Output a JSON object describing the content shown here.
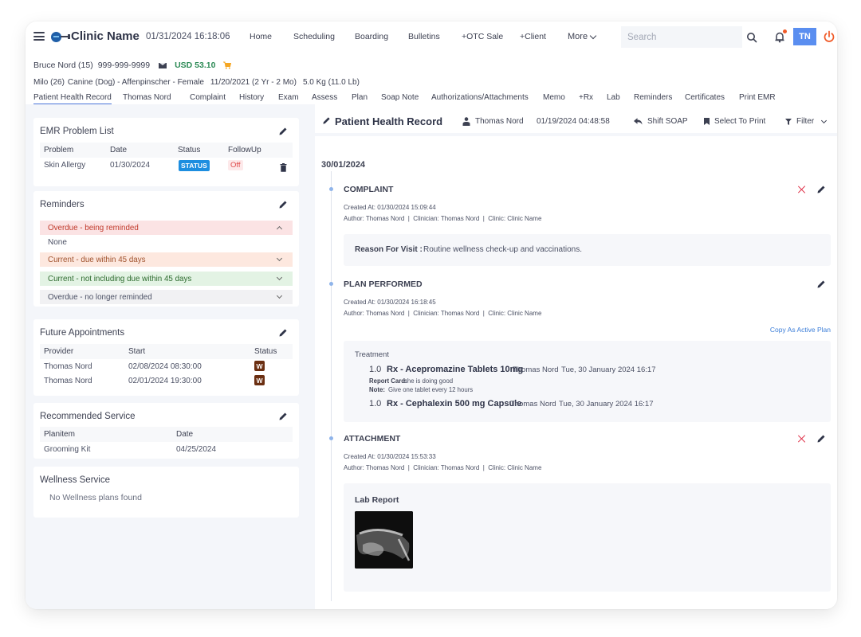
{
  "topbar": {
    "clinic_name": "Clinic Name",
    "datetime": "01/31/2024 16:18:06",
    "nav": [
      "Home",
      "Scheduling",
      "Boarding",
      "Bulletins",
      "+OTC Sale",
      "+Client"
    ],
    "more_label": "More",
    "search_placeholder": "Search",
    "user_initials": "TN",
    "icons": {
      "menu": "hamburger-icon",
      "search": "search-icon",
      "notifications": "bell-icon",
      "logout": "power-icon"
    }
  },
  "client": {
    "name": "Bruce Nord (15)",
    "phone": "999-999-9999",
    "balance": "USD 53.10"
  },
  "patient": {
    "name": "Milo (26)",
    "species_breed_sex": "Canine (Dog) - Affenpinscher - Female",
    "dob_age": "11/20/2021 (2 Yr - 2 Mo)",
    "weight": "5.0 Kg (11.0 Lb)"
  },
  "tabs": [
    "Patient Health Record",
    "Thomas Nord",
    "Complaint",
    "History",
    "Exam",
    "Assess",
    "Plan",
    "Soap Note",
    "Authorizations/Attachments",
    "Memo",
    "+Rx",
    "Lab",
    "Reminders",
    "Certificates",
    "Print EMR"
  ],
  "active_tab": "Patient Health Record",
  "problem_list": {
    "title": "EMR Problem List",
    "columns": [
      "Problem",
      "Date",
      "Status",
      "FollowUp"
    ],
    "rows": [
      {
        "problem": "Skin Allergy",
        "date": "01/30/2024",
        "status": "STATUS",
        "followup": "Off"
      }
    ]
  },
  "reminders": {
    "title": "Reminders",
    "groups": [
      {
        "label": "Overdue - being reminded",
        "expanded": true,
        "content": "None",
        "color": "#fbe3e4",
        "text_color": "#c0392b"
      },
      {
        "label": "Current - due within 45 days",
        "expanded": false,
        "color": "#fde8df",
        "text_color": "#a0522d"
      },
      {
        "label": "Current - not including due within 45 days",
        "expanded": false,
        "color": "#e3f3e4",
        "text_color": "#2e6b2f"
      },
      {
        "label": "Overdue - no longer reminded",
        "expanded": false,
        "color": "#f1f1f3",
        "text_color": "#4b5064"
      }
    ]
  },
  "appointments": {
    "title": "Future Appointments",
    "columns": [
      "Provider",
      "Start",
      "Status"
    ],
    "rows": [
      {
        "provider": "Thomas Nord",
        "start": "02/08/2024 08:30:00",
        "status": "W"
      },
      {
        "provider": "Thomas Nord",
        "start": "02/01/2024 19:30:00",
        "status": "W"
      }
    ]
  },
  "recommended": {
    "title": "Recommended Service",
    "columns": [
      "Planitem",
      "Date"
    ],
    "rows": [
      {
        "item": "Grooming Kit",
        "date": "04/25/2024"
      }
    ]
  },
  "wellness": {
    "title": "Wellness Service",
    "empty": "No Wellness plans found"
  },
  "record": {
    "title": "Patient Health Record",
    "provider": "Thomas Nord",
    "datetime": "01/19/2024 04:48:58",
    "actions": {
      "shift_soap": "Shift SOAP",
      "select_print": "Select To Print",
      "filter": "Filter"
    },
    "date_heading": "30/01/2024",
    "entries": {
      "complaint": {
        "title": "COMPLAINT",
        "created": "Created At: 01/30/2024 15:09:44",
        "meta": "Author: Thomas Nord  |  Clinician: Thomas Nord  |  Clinic: Clinic Name",
        "reason_label": "Reason For Visit :",
        "reason_value": "Routine wellness check-up and vaccinations."
      },
      "plan": {
        "title": "PLAN PERFORMED",
        "created": "Created At: 01/30/2024 16:18:45",
        "meta": "Author: Thomas Nord  |  Clinician: Thomas Nord  |  Clinic: Clinic Name",
        "copy_link": "Copy As Active Plan",
        "treatment_label": "Treatment",
        "items": [
          {
            "qty": "1.0",
            "name": "Rx - Acepromazine Tablets 10mg",
            "provider": "Thomas Nord",
            "datetime": "Tue, 30 January 2024 16:17",
            "report_card_label": "Report Card:",
            "report_card": "she is doing good",
            "note_label": "Note:",
            "note": "Give one tablet every 12 hours"
          },
          {
            "qty": "1.0",
            "name": "Rx - Cephalexin 500 mg Capsule",
            "provider": "Thomas Nord",
            "datetime": "Tue, 30 January 2024 16:17"
          }
        ]
      },
      "attachment": {
        "title": "ATTACHMENT",
        "created": "Created At: 01/30/2024 15:53:33",
        "meta": "Author: Thomas Nord  |  Clinician: Thomas Nord  |  Clinic: Clinic Name",
        "file_label": "Lab Report",
        "thumbnail": "x-ray-image"
      }
    }
  },
  "colors": {
    "accent": "#4a74d9",
    "avatar_bg": "#5a8ef0",
    "status_badge": "#1d8ee0",
    "appointment_badge": "#6b2f12",
    "balance": "#2e8b57",
    "delete": "#e0394f",
    "power": "#f05a28"
  }
}
